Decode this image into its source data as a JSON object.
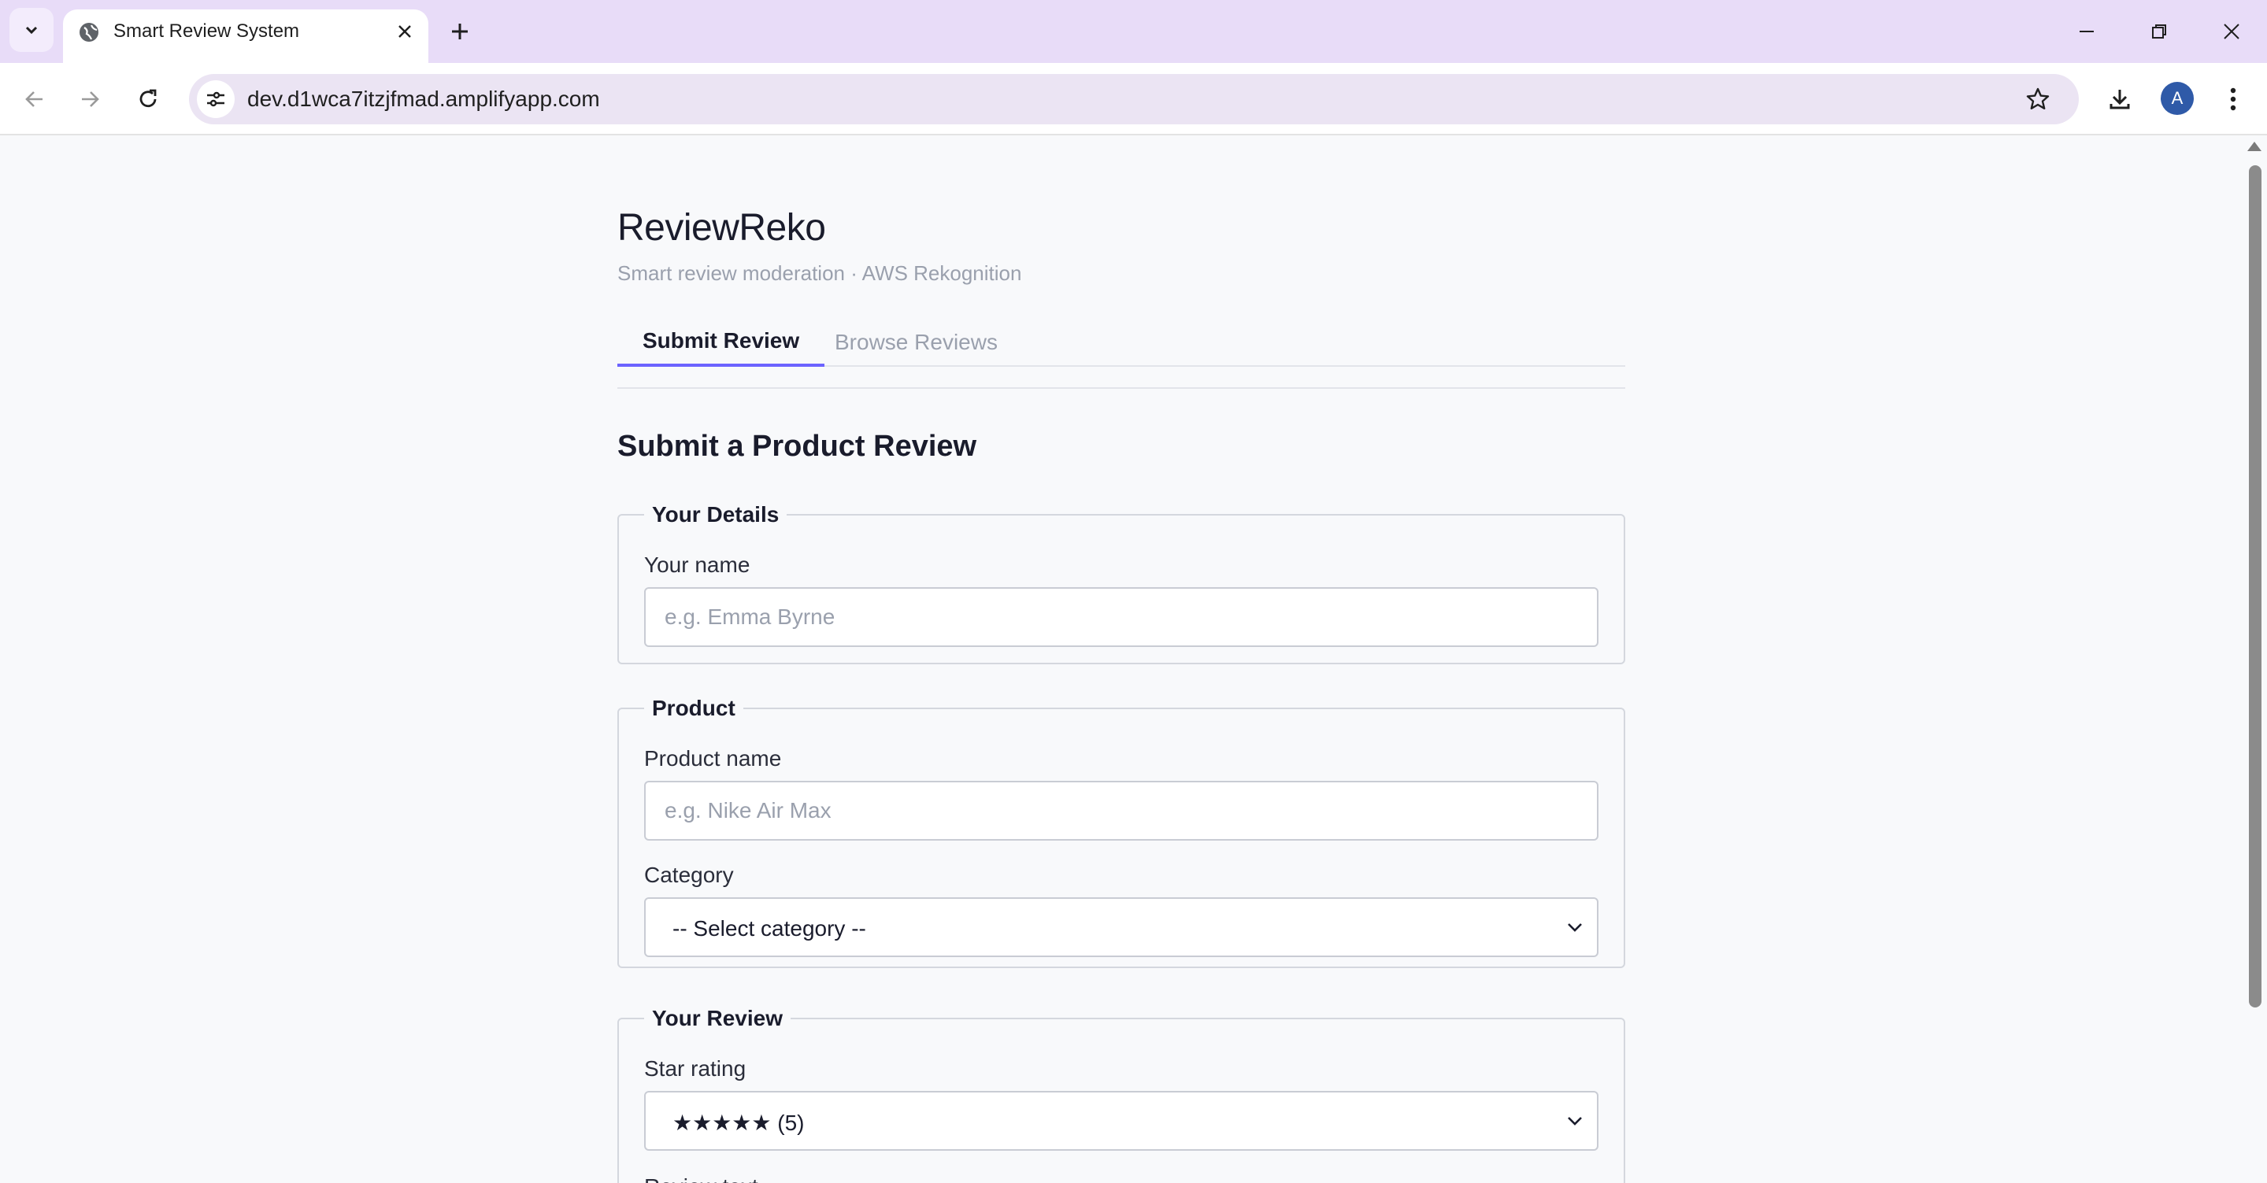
{
  "browser": {
    "tab_title": "Smart Review System",
    "url": "dev.d1wca7itzjfmad.amplifyapp.com",
    "profile_initial": "A"
  },
  "app": {
    "brand": "ReviewReko",
    "subtitle": "Smart review moderation · AWS Rekognition",
    "tabs": [
      {
        "label": "Submit Review",
        "active": true
      },
      {
        "label": "Browse Reviews",
        "active": false
      }
    ],
    "section_title": "Submit a Product Review"
  },
  "form": {
    "details": {
      "legend": "Your Details",
      "name_label": "Your name",
      "name_placeholder": "e.g. Emma Byrne"
    },
    "product": {
      "legend": "Product",
      "product_label": "Product name",
      "product_placeholder": "e.g. Nike Air Max",
      "category_label": "Category",
      "category_value": "-- Select category --"
    },
    "review": {
      "legend": "Your Review",
      "rating_label": "Star rating",
      "rating_value": "★★★★★ (5)",
      "text_label": "Review text"
    }
  },
  "colors": {
    "accent": "#6c63ff",
    "tabbar": "#e8dcf8",
    "page_bg": "#f8f9fb"
  }
}
